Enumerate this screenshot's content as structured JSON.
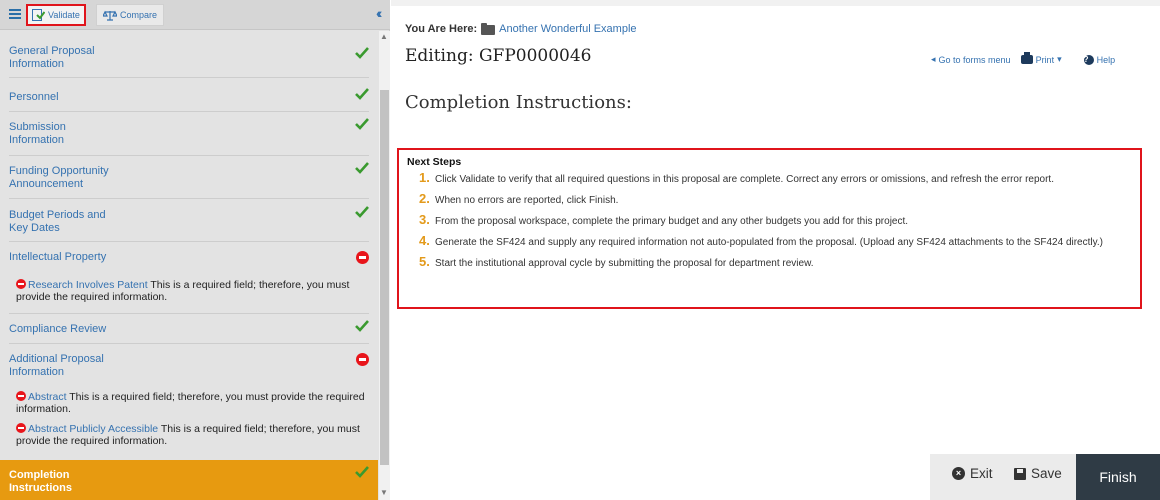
{
  "toolbar": {
    "validate_label": "Validate",
    "compare_label": "Compare",
    "collapse_icon": "double-chevron-left-icon"
  },
  "sidebar": {
    "items": [
      {
        "label": "General Proposal Information",
        "status": "complete"
      },
      {
        "label": "Personnel",
        "status": "complete"
      },
      {
        "label": "Submission Information",
        "status": "complete"
      },
      {
        "label": "Funding Opportunity Announcement",
        "status": "complete"
      },
      {
        "label": "Budget Periods and Key Dates",
        "status": "complete"
      },
      {
        "label": "Intellectual Property",
        "status": "error"
      },
      {
        "label": "Compliance Review",
        "status": "complete"
      },
      {
        "label": "Additional Proposal Information",
        "status": "error"
      },
      {
        "label": "Completion Instructions",
        "status": "complete",
        "active": true
      }
    ],
    "errors": {
      "patent_link": "Research Involves Patent",
      "patent_text": "This is a required field; therefore, you must provide the required information.",
      "abstract_link": "Abstract",
      "abstract_text": "This is a required field; therefore, you must provide the required information.",
      "public_link": "Abstract Publicly Accessible",
      "public_text": "This is a required field; therefore, you must provide the required information."
    }
  },
  "header": {
    "you_are_here": "You Are Here:",
    "breadcrumb": "Another Wonderful Example",
    "editing_title": "Editing: GFP0000046",
    "go_to_forms": "Go to forms menu",
    "print": "Print",
    "help": "Help"
  },
  "main": {
    "section_title": "Completion Instructions:",
    "next_steps_title": "Next Steps",
    "steps": [
      {
        "num": "1.",
        "text": "Click Validate to verify that all required questions in this proposal are complete. Correct any errors or omissions, and refresh the error report."
      },
      {
        "num": "2.",
        "text": "When no errors are reported, click Finish."
      },
      {
        "num": "3.",
        "text": "From the proposal workspace, complete the primary budget and any other budgets you add for this project."
      },
      {
        "num": "4.",
        "text": "Generate the SF424 and supply any required information not auto-populated from the proposal. (Upload any SF424 attachments to the SF424 directly.)"
      },
      {
        "num": "5.",
        "text": "Start the institutional approval cycle by submitting the proposal for department review."
      }
    ]
  },
  "footer": {
    "exit_label": "Exit",
    "save_label": "Save",
    "finish_label": "Finish"
  },
  "colors": {
    "accent": "#e79a10",
    "link": "#3572b0",
    "error": "#e8151b",
    "success": "#3a9a2f",
    "highlight_box": "#e0141b",
    "finish_bg": "#2f3b45"
  }
}
